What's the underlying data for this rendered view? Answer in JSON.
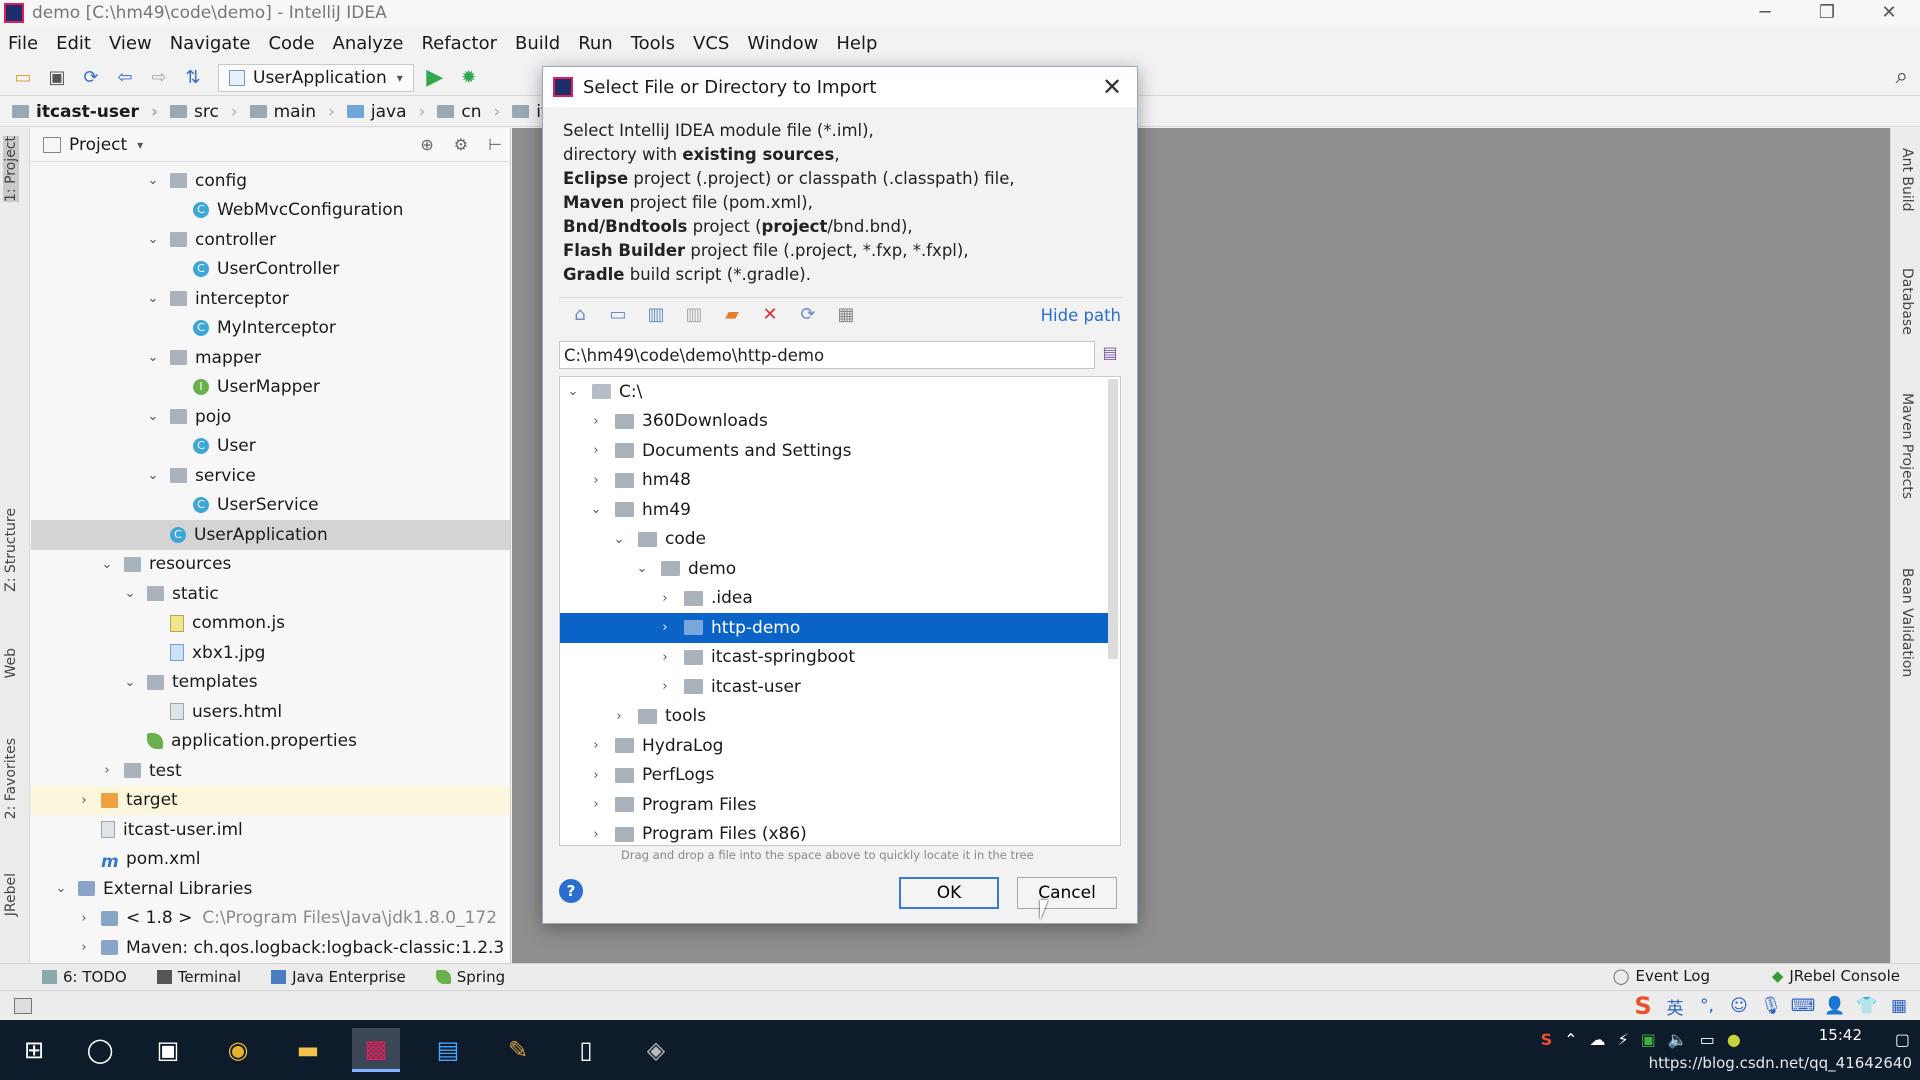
{
  "window": {
    "title": "demo [C:\\hm49\\code\\demo] - IntelliJ IDEA",
    "controls": [
      "─",
      "❐",
      "✕"
    ]
  },
  "menu": [
    "File",
    "Edit",
    "View",
    "Navigate",
    "Code",
    "Analyze",
    "Refactor",
    "Build",
    "Run",
    "Tools",
    "VCS",
    "Window",
    "Help"
  ],
  "toolbar": {
    "run_config": "UserApplication"
  },
  "breadcrumb": [
    "itcast-user",
    "src",
    "main",
    "java",
    "cn",
    "itcast"
  ],
  "left_tabs": [
    "1: Project",
    "Z: Structure",
    "Web",
    "2: Favorites",
    "JRebel"
  ],
  "right_tabs": [
    "Ant Build",
    "Database",
    "Maven Projects",
    "Bean Validation"
  ],
  "project_panel": {
    "title": "Project",
    "tree": [
      {
        "label": "config",
        "depth": 3,
        "arrow": "⌄",
        "icon": "folder"
      },
      {
        "label": "WebMvcConfiguration",
        "depth": 4,
        "arrow": "",
        "icon": "class"
      },
      {
        "label": "controller",
        "depth": 3,
        "arrow": "⌄",
        "icon": "folder"
      },
      {
        "label": "UserController",
        "depth": 4,
        "arrow": "",
        "icon": "class"
      },
      {
        "label": "interceptor",
        "depth": 3,
        "arrow": "⌄",
        "icon": "folder"
      },
      {
        "label": "MyInterceptor",
        "depth": 4,
        "arrow": "",
        "icon": "class"
      },
      {
        "label": "mapper",
        "depth": 3,
        "arrow": "⌄",
        "icon": "folder"
      },
      {
        "label": "UserMapper",
        "depth": 4,
        "arrow": "",
        "icon": "iface"
      },
      {
        "label": "pojo",
        "depth": 3,
        "arrow": "⌄",
        "icon": "folder"
      },
      {
        "label": "User",
        "depth": 4,
        "arrow": "",
        "icon": "class"
      },
      {
        "label": "service",
        "depth": 3,
        "arrow": "⌄",
        "icon": "folder"
      },
      {
        "label": "UserService",
        "depth": 4,
        "arrow": "",
        "icon": "class"
      },
      {
        "label": "UserApplication",
        "depth": 3,
        "arrow": "",
        "icon": "class",
        "state": "selected"
      },
      {
        "label": "resources",
        "depth": 1,
        "arrow": "⌄",
        "icon": "folder-res"
      },
      {
        "label": "static",
        "depth": 2,
        "arrow": "⌄",
        "icon": "folder"
      },
      {
        "label": "common.js",
        "depth": 3,
        "arrow": "",
        "icon": "file-js"
      },
      {
        "label": "xbx1.jpg",
        "depth": 3,
        "arrow": "",
        "icon": "file-img"
      },
      {
        "label": "templates",
        "depth": 2,
        "arrow": "⌄",
        "icon": "folder"
      },
      {
        "label": "users.html",
        "depth": 3,
        "arrow": "",
        "icon": "file"
      },
      {
        "label": "application.properties",
        "depth": 2,
        "arrow": "",
        "icon": "leaf"
      },
      {
        "label": "test",
        "depth": 1,
        "arrow": "›",
        "icon": "folder"
      },
      {
        "label": "target",
        "depth": 0,
        "arrow": "›",
        "icon": "folder-orange",
        "state": "highlight"
      },
      {
        "label": "itcast-user.iml",
        "depth": 0,
        "arrow": "",
        "icon": "file"
      },
      {
        "label": "pom.xml",
        "depth": 0,
        "arrow": "",
        "icon": "xml"
      },
      {
        "label": "External Libraries",
        "depth": -1,
        "arrow": "⌄",
        "icon": "lib"
      },
      {
        "label": "< 1.8 >",
        "depth": 0,
        "arrow": "›",
        "icon": "lib",
        "extra": "C:\\Program Files\\Java\\jdk1.8.0_172"
      },
      {
        "label": "Maven: ch.qos.logback:logback-classic:1.2.3",
        "depth": 0,
        "arrow": "›",
        "icon": "lib"
      }
    ]
  },
  "bottom_tools": [
    "6: TODO",
    "Terminal",
    "Java Enterprise",
    "Spring"
  ],
  "bottom_right_tools": [
    "Event Log",
    "JRebel Console"
  ],
  "dialog": {
    "title": "Select File or Directory to Import",
    "desc": [
      {
        "parts": [
          {
            "t": "Select IntelliJ IDEA module file (*.iml),",
            "b": false
          }
        ]
      },
      {
        "parts": [
          {
            "t": "directory with ",
            "b": false
          },
          {
            "t": "existing sources",
            "b": true
          },
          {
            "t": ",",
            "b": false
          }
        ]
      },
      {
        "parts": [
          {
            "t": "Eclipse",
            "b": true
          },
          {
            "t": " project (.project) or classpath (.classpath) file,",
            "b": false
          }
        ]
      },
      {
        "parts": [
          {
            "t": "Maven",
            "b": true
          },
          {
            "t": " project file (pom.xml),",
            "b": false
          }
        ]
      },
      {
        "parts": [
          {
            "t": "Bnd/Bndtools",
            "b": true
          },
          {
            "t": " project (",
            "b": false
          },
          {
            "t": "project",
            "b": true
          },
          {
            "t": "/bnd.bnd),",
            "b": false
          }
        ]
      },
      {
        "parts": [
          {
            "t": "Flash Builder",
            "b": true
          },
          {
            "t": " project file (.project, *.fxp, *.fxpl),",
            "b": false
          }
        ]
      },
      {
        "parts": [
          {
            "t": "Gradle",
            "b": true
          },
          {
            "t": " build script (*.gradle).",
            "b": false
          }
        ]
      }
    ],
    "hide_path": "Hide path",
    "path_value": "C:\\hm49\\code\\demo\\http-demo",
    "tree": [
      {
        "label": "C:\\",
        "depth": 0,
        "arrow": "⌄",
        "icon": "drive"
      },
      {
        "label": "360Downloads",
        "depth": 1,
        "arrow": "›"
      },
      {
        "label": "Documents and Settings",
        "depth": 1,
        "arrow": "›"
      },
      {
        "label": "hm48",
        "depth": 1,
        "arrow": "›"
      },
      {
        "label": "hm49",
        "depth": 1,
        "arrow": "⌄"
      },
      {
        "label": "code",
        "depth": 2,
        "arrow": "⌄"
      },
      {
        "label": "demo",
        "depth": 3,
        "arrow": "⌄"
      },
      {
        "label": ".idea",
        "depth": 4,
        "arrow": "›"
      },
      {
        "label": "http-demo",
        "depth": 4,
        "arrow": "›",
        "selected": true
      },
      {
        "label": "itcast-springboot",
        "depth": 4,
        "arrow": "›"
      },
      {
        "label": "itcast-user",
        "depth": 4,
        "arrow": "›"
      },
      {
        "label": "tools",
        "depth": 2,
        "arrow": "›"
      },
      {
        "label": "HydraLog",
        "depth": 1,
        "arrow": "›"
      },
      {
        "label": "PerfLogs",
        "depth": 1,
        "arrow": "›"
      },
      {
        "label": "Program Files",
        "depth": 1,
        "arrow": "›"
      },
      {
        "label": "Program Files (x86)",
        "depth": 1,
        "arrow": "›"
      }
    ],
    "drag_hint": "Drag and drop a file into the space above to quickly locate it in the tree",
    "ok_label": "OK",
    "cancel_label": "Cancel",
    "help_label": "?"
  },
  "taskbar": {
    "clock": "15:42",
    "watermark": "https://blog.csdn.net/qq_41642640"
  }
}
